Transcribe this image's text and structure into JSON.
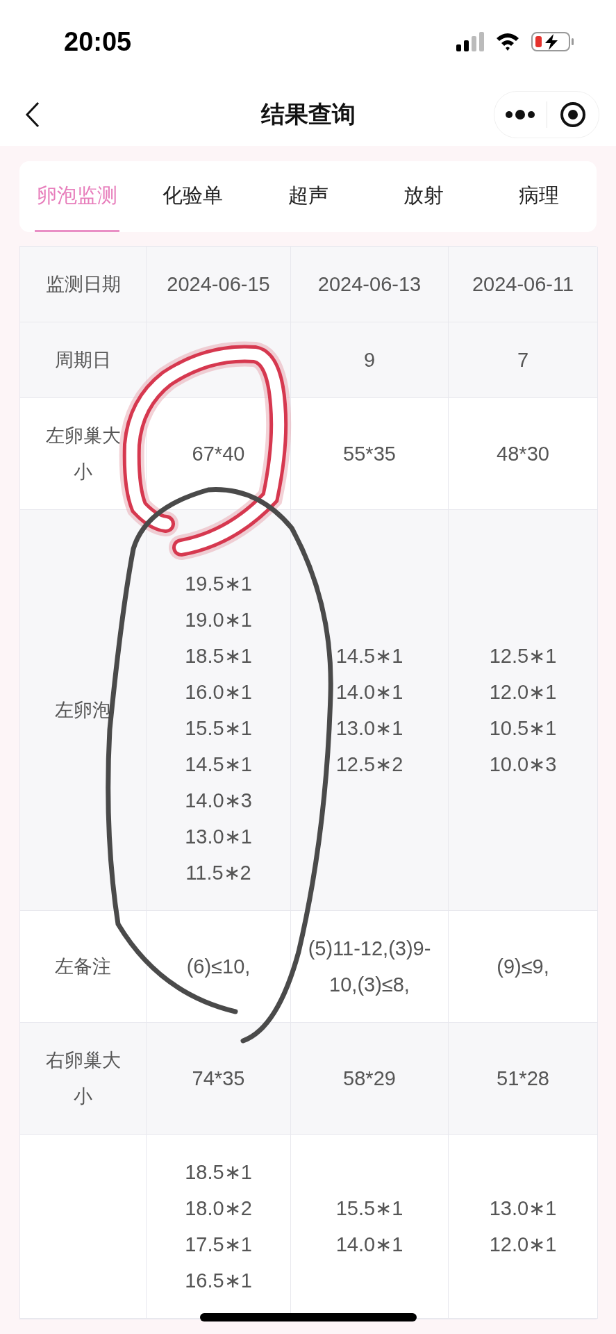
{
  "status_bar": {
    "time": "20:05"
  },
  "nav": {
    "title": "结果查询"
  },
  "tabs": [
    {
      "label": "卵泡监测",
      "selected": true
    },
    {
      "label": "化验单",
      "selected": false
    },
    {
      "label": "超声",
      "selected": false
    },
    {
      "label": "放射",
      "selected": false
    },
    {
      "label": "病理",
      "selected": false
    }
  ],
  "table": {
    "header": {
      "label": "监测日期",
      "dates": [
        "2024-06-15",
        "2024-06-13",
        "2024-06-11"
      ]
    },
    "rows": [
      {
        "kind": "text",
        "label": "周期日",
        "cells": [
          null,
          "9",
          "7"
        ]
      },
      {
        "kind": "text",
        "label": "左卵巢大小",
        "cells": [
          "67*40",
          "55*35",
          "48*30"
        ]
      },
      {
        "kind": "list",
        "label": "左卵泡",
        "cells": [
          [
            "19.5∗1",
            "19.0∗1",
            "18.5∗1",
            "16.0∗1",
            "15.5∗1",
            "14.5∗1",
            "14.0∗3",
            "13.0∗1",
            "11.5∗2"
          ],
          [
            "14.5∗1",
            "14.0∗1",
            "13.0∗1",
            "12.5∗2"
          ],
          [
            "12.5∗1",
            "12.0∗1",
            "10.5∗1",
            "10.0∗3"
          ]
        ]
      },
      {
        "kind": "text",
        "label": "左备注",
        "cells": [
          "(6)≤10,",
          "(5)11-12,(3)9-10,(3)≤8,",
          "(9)≤9,"
        ]
      },
      {
        "kind": "text",
        "label": "右卵巢大小",
        "cells": [
          "74*35",
          "58*29",
          "51*28"
        ]
      },
      {
        "kind": "list",
        "cells": [
          [
            "18.5∗1",
            "18.0∗2",
            "17.5∗1",
            "16.5∗1"
          ],
          [
            "15.5∗1",
            "14.0∗1"
          ],
          [
            "13.0∗1",
            "12.0∗1"
          ]
        ]
      }
    ]
  },
  "annotations": [
    {
      "kind": "loop"
    },
    {
      "kind": "stroke"
    }
  ]
}
